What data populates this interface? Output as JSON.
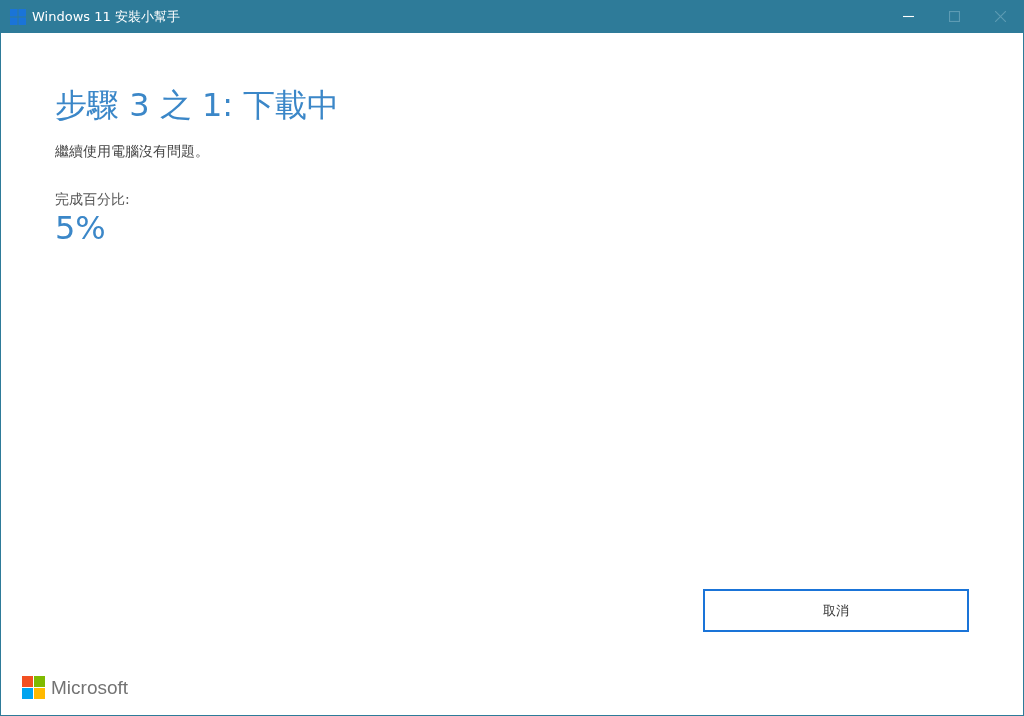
{
  "window": {
    "title": "Windows 11 安裝小幫手"
  },
  "window_controls": [
    {
      "kind": "minimize",
      "disabled": false
    },
    {
      "kind": "maximize",
      "disabled": true
    },
    {
      "kind": "close",
      "disabled": true
    }
  ],
  "heading": "步驟 3 之 1: 下載中",
  "message": "繼續使用電腦沒有問題。",
  "progress": {
    "label": "完成百分比:",
    "value": "5%"
  },
  "buttons": [
    "取消"
  ],
  "footer": {
    "brand": "Microsoft"
  }
}
